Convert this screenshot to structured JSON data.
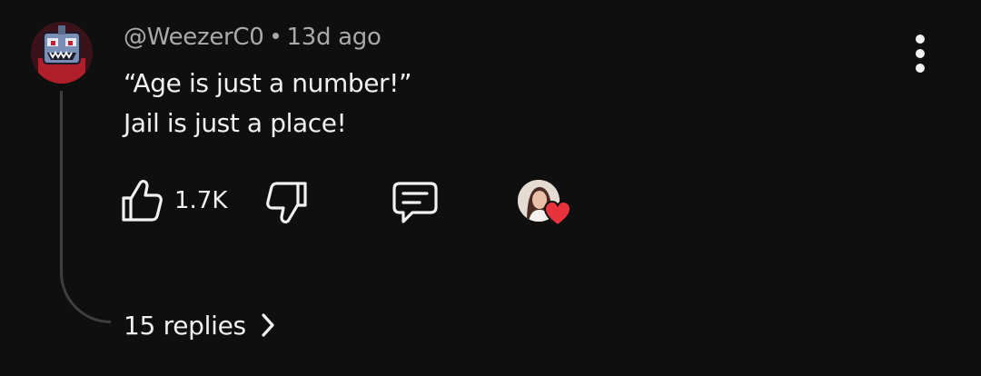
{
  "comment": {
    "author": "@WeezerC0",
    "timestamp": "13d ago",
    "text_lines": [
      "“Age is just a number!”",
      "Jail is just a place!"
    ],
    "like_count": "1.7K",
    "replies_label": "15 replies"
  },
  "icons": {
    "avatar": "robot-avatar",
    "more": "more-vertical-icon",
    "like": "thumbs-up-icon",
    "dislike": "thumbs-down-icon",
    "reply": "comment-icon",
    "creator_heart": "heart-icon",
    "replies": "chevron-right-icon"
  },
  "colors": {
    "background": "#0f0f0f",
    "primary_text": "#f1f1f1",
    "secondary_text": "#aaaaaa",
    "heart": "#e8333d",
    "thread_line": "#3f3f3f"
  }
}
